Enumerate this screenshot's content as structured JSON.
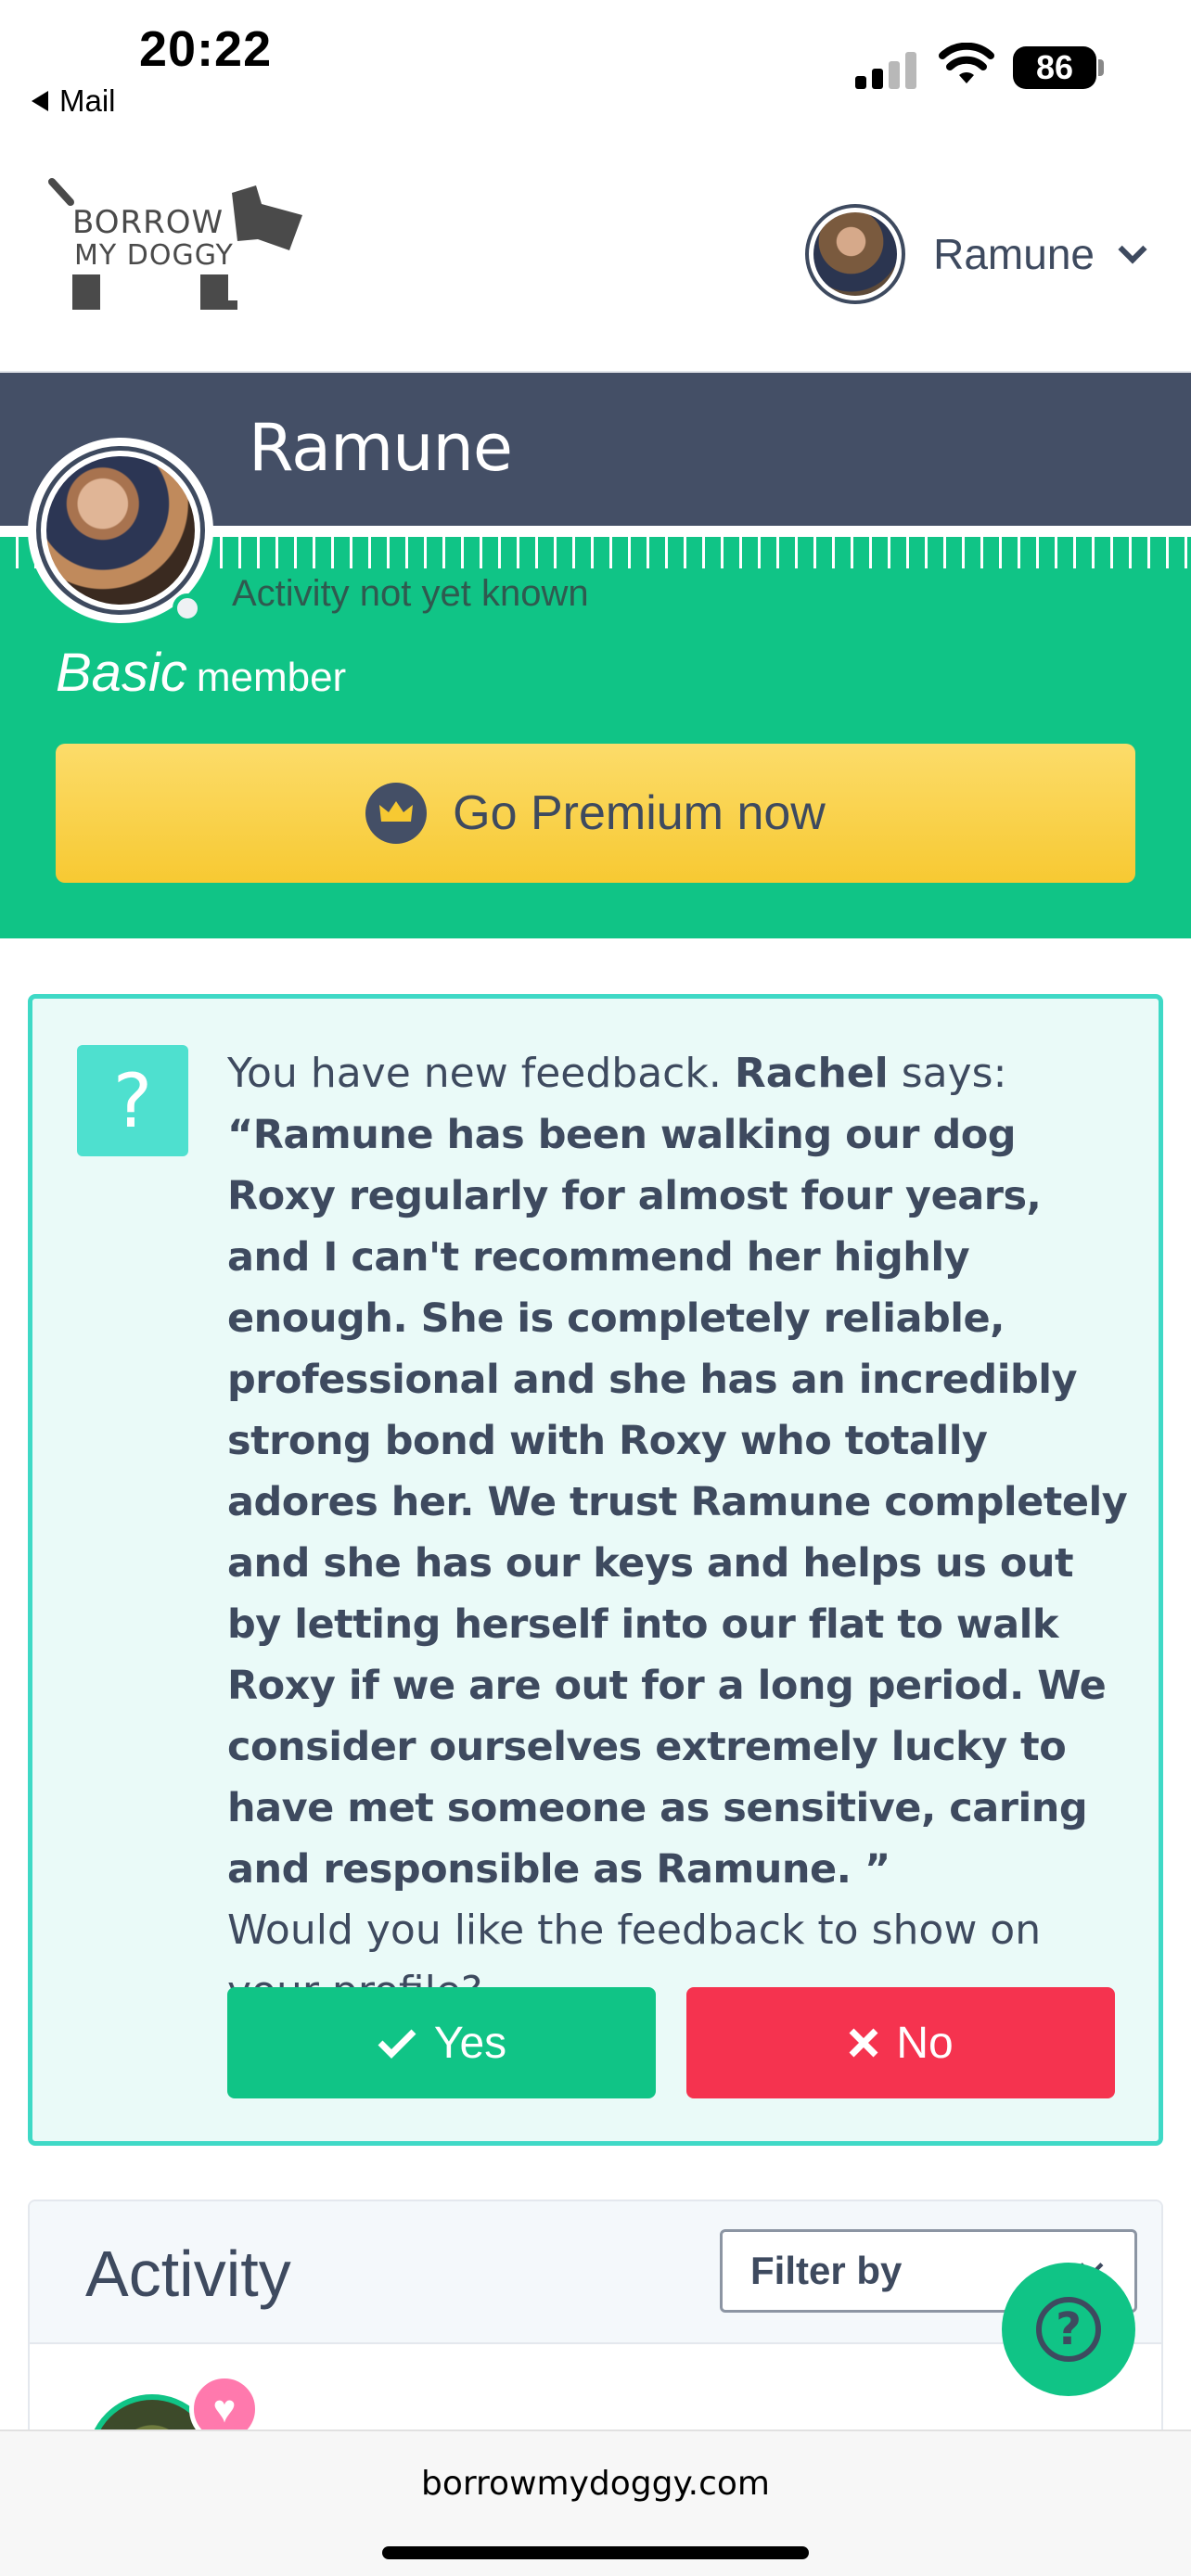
{
  "status_bar": {
    "time": "20:22",
    "back_label": "Mail",
    "battery": "86"
  },
  "header": {
    "logo_line1": "BORROW",
    "logo_line2": "MY DOGGY",
    "user_name": "Ramune"
  },
  "profile": {
    "name": "Ramune",
    "activity_status": "Activity not yet known",
    "tier": "Basic",
    "tier_suffix": "member",
    "premium_button": "Go Premium now"
  },
  "feedback": {
    "intro": "You have new feedback.",
    "author": "Rachel",
    "says": "says:",
    "quote": "“Ramune has been walking our dog Roxy regularly for almost four years, and I can't recommend her highly enough. She is completely reliable, professional and she has an incredibly strong bond with Roxy who totally adores her. We trust Ramune completely and she has our keys and helps us out by letting herself into our flat to walk Roxy if we are out for a long period. We consider ourselves extremely lucky to have met someone as sensitive, caring and responsible as Ramune. ”",
    "question": "Would you like the feedback to show on your profile?",
    "yes_label": "Yes",
    "no_label": "No"
  },
  "activity": {
    "title": "Activity",
    "filter_label": "Filter by"
  },
  "browser": {
    "url": "borrowmydoggy.com"
  },
  "colors": {
    "brand_green": "#10c486",
    "navy": "#444f66",
    "premium_yellow": "#f7c932",
    "no_red": "#f5334f",
    "feedback_border": "#3fd9c6"
  }
}
